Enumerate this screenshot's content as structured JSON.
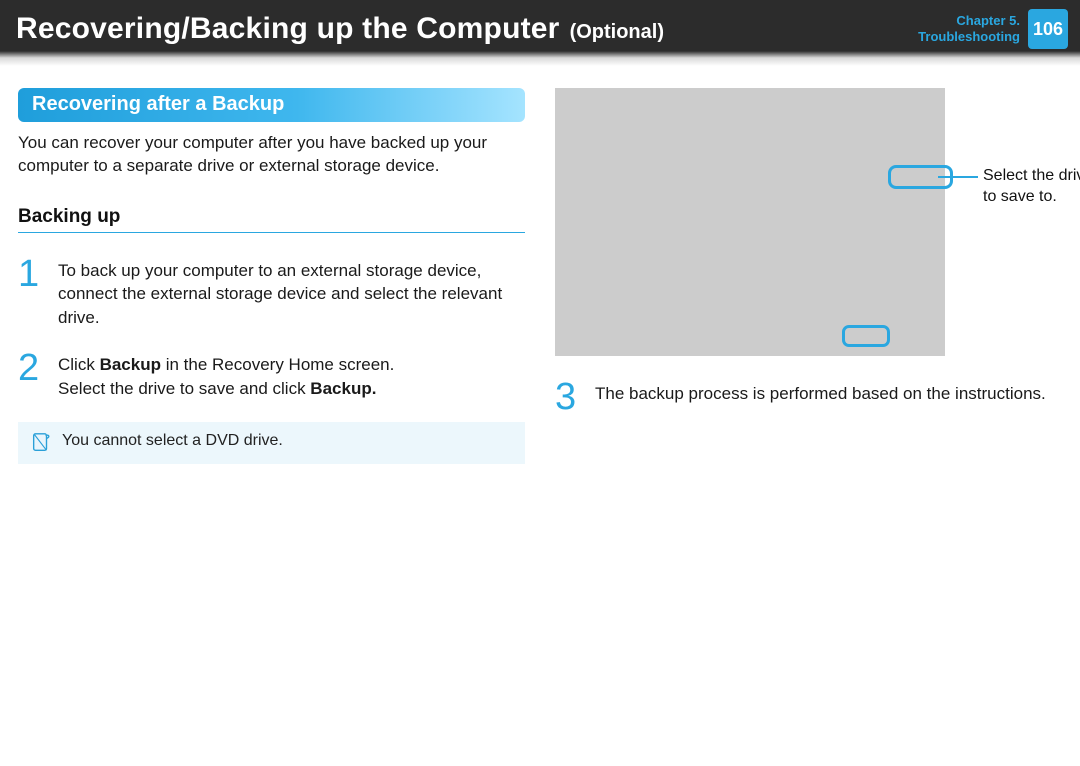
{
  "header": {
    "title": "Recovering/Backing up the Computer",
    "title_optional": "(Optional)",
    "chapter_line1": "Chapter 5.",
    "chapter_line2": "Troubleshooting",
    "page_number": "106"
  },
  "section": {
    "heading": "Recovering after a Backup",
    "intro": "You can recover your computer after you have backed up your computer to a separate drive or external storage device."
  },
  "subsection": {
    "title": "Backing up"
  },
  "steps": {
    "s1": "To back up your computer to an external storage device, connect the external storage device and select the relevant drive.",
    "s2a": "Click ",
    "s2b": "Backup",
    "s2c": " in the Recovery Home screen.",
    "s2d": "Select the drive to save and click ",
    "s2e": "Backup.",
    "s3": "The backup process is performed based on the instructions."
  },
  "note": {
    "text": "You cannot select a DVD drive."
  },
  "callout": {
    "line1": "Select the drive",
    "line2": "to save to."
  },
  "nums": {
    "n1": "1",
    "n2": "2",
    "n3": "3"
  }
}
